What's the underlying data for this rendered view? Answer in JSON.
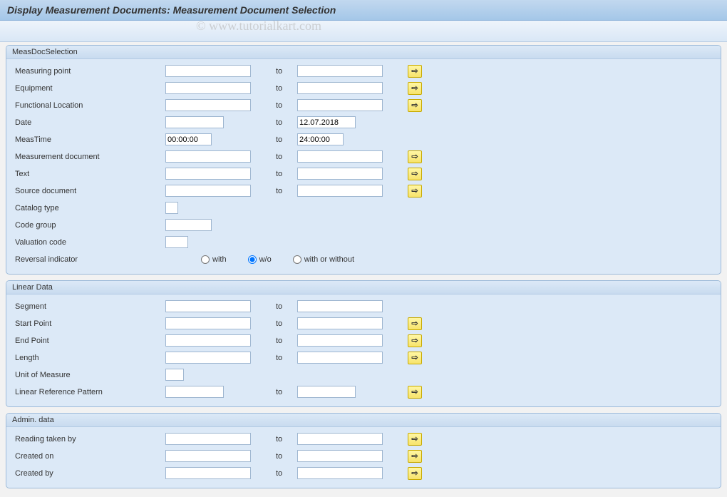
{
  "title": "Display Measurement Documents: Measurement Document Selection",
  "watermark": "© www.tutorialkart.com",
  "groups": {
    "measDoc": {
      "header": "MeasDocSelection",
      "rows": {
        "measPoint": {
          "label": "Measuring point",
          "from": "",
          "to_lbl": "to",
          "to": "",
          "multi": true
        },
        "equipment": {
          "label": "Equipment",
          "from": "",
          "to_lbl": "to",
          "to": "",
          "multi": true
        },
        "funcLoc": {
          "label": "Functional Location",
          "from": "",
          "to_lbl": "to",
          "to": "",
          "multi": true
        },
        "date": {
          "label": "Date",
          "from": "",
          "to_lbl": "to",
          "to": "12.07.2018"
        },
        "measTime": {
          "label": "MeasTime",
          "from": "00:00:00",
          "to_lbl": "to",
          "to": "24:00:00"
        },
        "measDoc": {
          "label": "Measurement document",
          "from": "",
          "to_lbl": "to",
          "to": "",
          "multi": true
        },
        "text": {
          "label": "Text",
          "from": "",
          "to_lbl": "to",
          "to": "",
          "multi": true
        },
        "sourceDoc": {
          "label": "Source document",
          "from": "",
          "to_lbl": "to",
          "to": "",
          "multi": true
        },
        "catalogType": {
          "label": "Catalog type",
          "from": ""
        },
        "codeGroup": {
          "label": "Code group",
          "from": ""
        },
        "valuation": {
          "label": "Valuation code",
          "from": ""
        },
        "reversal": {
          "label": "Reversal indicator",
          "options": {
            "with": "with",
            "wo": "w/o",
            "wow": "with or without"
          }
        }
      }
    },
    "linear": {
      "header": "Linear Data",
      "rows": {
        "segment": {
          "label": "Segment",
          "from": "",
          "to_lbl": "to",
          "to": ""
        },
        "startPt": {
          "label": "Start Point",
          "from": "",
          "to_lbl": "to",
          "to": "",
          "multi": true
        },
        "endPt": {
          "label": "End Point",
          "from": "",
          "to_lbl": "to",
          "to": "",
          "multi": true
        },
        "length": {
          "label": "Length",
          "from": "",
          "to_lbl": "to",
          "to": "",
          "multi": true
        },
        "uom": {
          "label": "Unit of Measure",
          "from": ""
        },
        "linRef": {
          "label": "Linear Reference Pattern",
          "from": "",
          "to_lbl": "to",
          "to": "",
          "multi": true
        }
      }
    },
    "admin": {
      "header": "Admin. data",
      "rows": {
        "readBy": {
          "label": "Reading taken by",
          "from": "",
          "to_lbl": "to",
          "to": "",
          "multi": true
        },
        "createdOn": {
          "label": "Created on",
          "from": "",
          "to_lbl": "to",
          "to": "",
          "multi": true
        },
        "createdBy": {
          "label": "Created by",
          "from": "",
          "to_lbl": "to",
          "to": "",
          "multi": true
        }
      }
    }
  }
}
